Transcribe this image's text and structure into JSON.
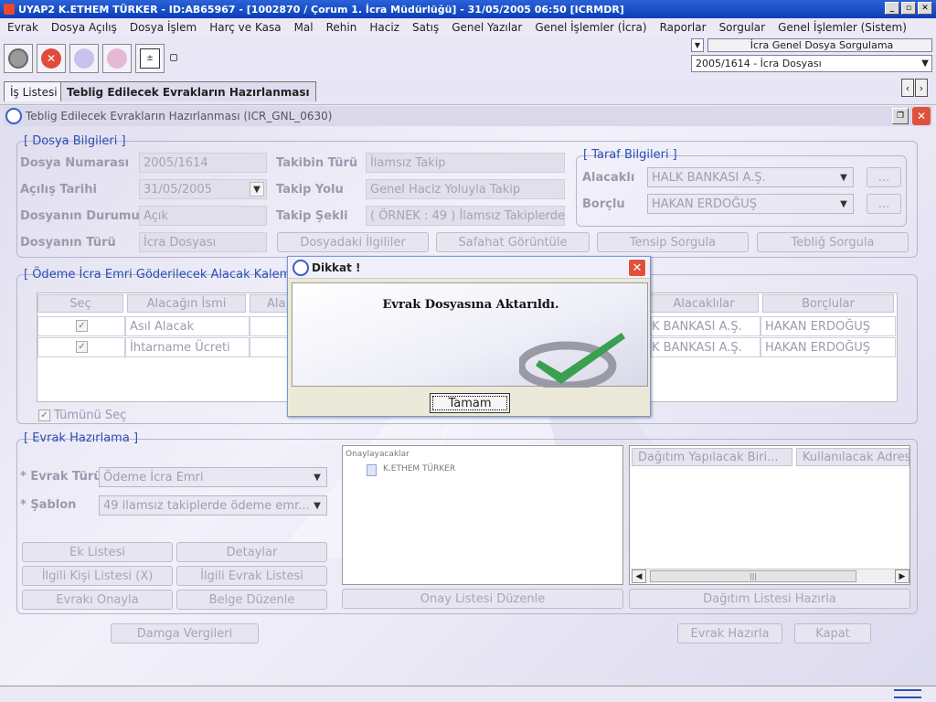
{
  "window": {
    "title": "UYAP2  K.ETHEM TÜRKER - ID:AB65967 - [1002870 / Çorum 1. İcra Müdürlüğü] - 31/05/2005 06:50 [ICRMDR]",
    "min": "_",
    "max": "▫",
    "close": "✕"
  },
  "menu": [
    "Evrak",
    "Dosya Açılış",
    "Dosya İşlem",
    "Harç ve Kasa",
    "Mal",
    "Rehin",
    "Haciz",
    "Satış",
    "Genel Yazılar",
    "Genel İşlemler (İcra)",
    "Raporlar",
    "Sorgular",
    "Genel İşlemler (Sistem)"
  ],
  "toolbar": {
    "query_label": "İcra Genel Dosya Sorgulama",
    "file_combo": "2005/1614 - İcra Dosyası"
  },
  "tabs": [
    "İş Listesi",
    "Teblig Edilecek Evrakların Hazırlanması"
  ],
  "subwindow": {
    "title": "Teblig Edilecek Evrakların Hazırlanması (ICR_GNL_0630)"
  },
  "dosya": {
    "group_title": "[ Dosya Bilgileri ]",
    "labels": {
      "no": "Dosya Numarası",
      "date": "Açılış Tarihi",
      "status": "Dosyanın Durumu",
      "type": "Dosyanın Türü",
      "takip_turu": "Takibin Türü",
      "takip_yolu": "Takip Yolu",
      "takip_sekli": "Takip Şekli"
    },
    "values": {
      "no": "2005/1614",
      "date": "31/05/2005",
      "status": "Açık",
      "type": "İcra Dosyası",
      "takip_turu": "İlamsız Takip",
      "takip_yolu": "Genel Haciz Yoluyla Takip",
      "takip_sekli": "( ÖRNEK  : 49 ) İlamsız Takiplerde"
    }
  },
  "taraf": {
    "group_title": "[ Taraf Bilgileri ]",
    "alacakli_label": "Alacaklı",
    "borclu_label": "Borçlu",
    "alacakli": "HALK BANKASI A.Ş.",
    "borclu": "HAKAN ERDOĞUŞ",
    "dots": "..."
  },
  "actions": [
    "Dosyadaki İlgililer",
    "Safahat Görüntüle",
    "Tensip Sorgula",
    "Tebliğ Sorgula"
  ],
  "odeme": {
    "group_title": "[ Ödeme İcra Emri Göderilecek Alacak Kalemle",
    "headers": [
      "Seç",
      "Alacağın İsmi",
      "Ala",
      "Alacaklılar",
      "Borçlular"
    ],
    "rows": [
      {
        "check": "✓",
        "name": "Asıl Alacak",
        "alacakli": "K BANKASI A.Ş.",
        "borclu": "HAKAN ERDOĞUŞ"
      },
      {
        "check": "✓",
        "name": "İhtarname Ücreti",
        "alacakli": "K BANKASI A.Ş.",
        "borclu": "HAKAN ERDOĞUŞ"
      }
    ],
    "select_all": "Tümünü Seç"
  },
  "evrak": {
    "group_title": "[ Evrak Hazırlama ]",
    "turu_label": "* Evrak Türü",
    "turu": "Ödeme İcra Emri",
    "sablon_label": "* Şablon",
    "sablon": "49 ilamsız takiplerde ödeme emr...",
    "tree_root": "Onaylayacaklar",
    "tree_item": "K.ETHEM TÜRKER",
    "dist_headers": [
      "Dağıtım Yapılacak Biri...",
      "Kullanılacak Adres"
    ],
    "buttons": [
      "Ek Listesi",
      "Detaylar",
      "İlgili Kişi Listesi (X)",
      "İlgili Evrak Listesi",
      "Evrakı Onayla",
      "Belge Düzenle"
    ],
    "onay_btn": "Onay Listesi Düzenle",
    "dagitim_btn": "Dağıtım Listesi Hazırla",
    "scroll_grip": "|||"
  },
  "footer": {
    "damga": "Damga Vergileri",
    "hazirla": "Evrak Hazırla",
    "kapat": "Kapat"
  },
  "dialog": {
    "title": "Dikkat !",
    "message": "Evrak Dosyasına Aktarıldı.",
    "ok": "Tamam",
    "close": "✕"
  },
  "colors": {
    "titlebar": "#0a3fb8",
    "accent": "#2a4fb5",
    "dialog_close": "#e0513b",
    "check": "#3aa050"
  }
}
